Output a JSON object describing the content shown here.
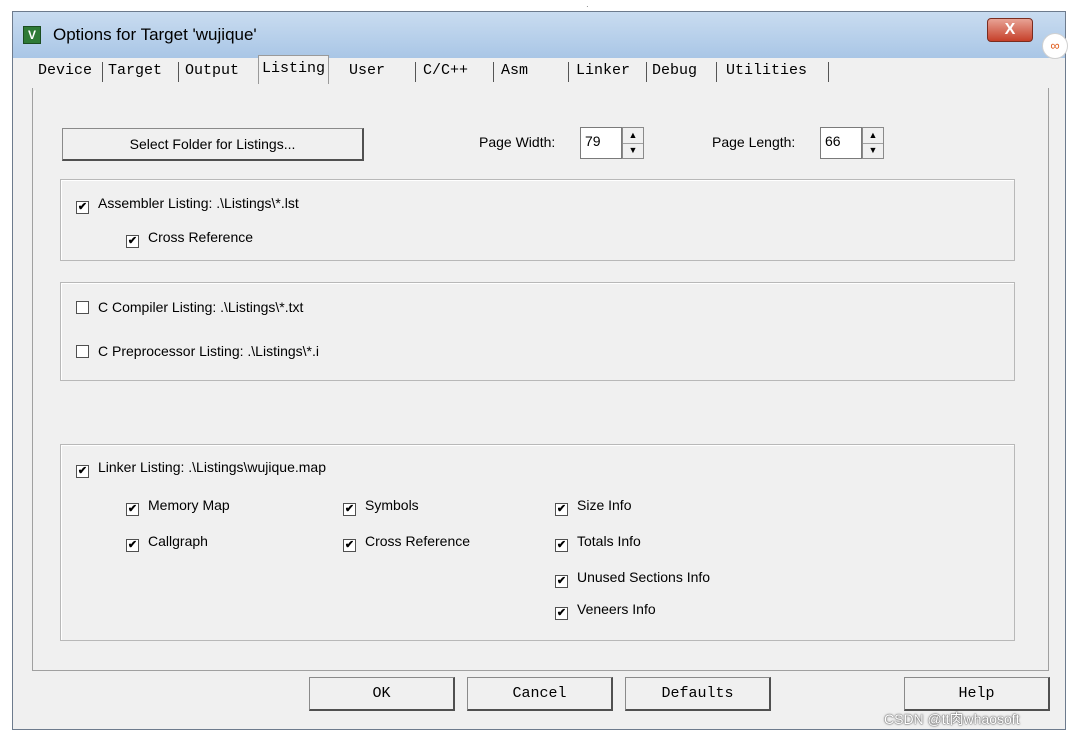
{
  "window": {
    "title": "Options for Target 'wujique'",
    "close_label": "X",
    "app_icon": "keil-uvision-icon"
  },
  "tabs": [
    {
      "label": "Device"
    },
    {
      "label": "Target"
    },
    {
      "label": "Output"
    },
    {
      "label": "Listing",
      "active": true
    },
    {
      "label": "User"
    },
    {
      "label": "C/C++"
    },
    {
      "label": "Asm"
    },
    {
      "label": "Linker"
    },
    {
      "label": "Debug"
    },
    {
      "label": "Utilities"
    }
  ],
  "listing": {
    "select_folder_label": "Select Folder for Listings...",
    "page_width_label": "Page Width:",
    "page_width_value": "79",
    "page_length_label": "Page Length:",
    "page_length_value": "66"
  },
  "assembler": {
    "listing": {
      "label": "Assembler Listing:  .\\Listings\\*.lst",
      "checked": true
    },
    "cross_reference": {
      "label": "Cross Reference",
      "checked": true
    }
  },
  "compiler": {
    "c_listing": {
      "label": "C Compiler Listing:  .\\Listings\\*.txt",
      "checked": false
    },
    "preprocessor": {
      "label": "C Preprocessor Listing:  .\\Listings\\*.i",
      "checked": false
    }
  },
  "linker": {
    "listing": {
      "label": "Linker Listing:  .\\Listings\\wujique.map",
      "checked": true
    },
    "memory_map": {
      "label": "Memory Map",
      "checked": true
    },
    "callgraph": {
      "label": "Callgraph",
      "checked": true
    },
    "symbols": {
      "label": "Symbols",
      "checked": true
    },
    "cross_reference": {
      "label": "Cross Reference",
      "checked": true
    },
    "size_info": {
      "label": "Size Info",
      "checked": true
    },
    "totals_info": {
      "label": "Totals Info",
      "checked": true
    },
    "unused_sections": {
      "label": "Unused Sections Info",
      "checked": true
    },
    "veneers_info": {
      "label": "Veneers Info",
      "checked": true
    }
  },
  "buttons": {
    "ok": "OK",
    "cancel": "Cancel",
    "defaults": "Defaults",
    "help": "Help"
  },
  "watermark": "CSDN @tt肉whaosoft",
  "check_glyph": "✔"
}
